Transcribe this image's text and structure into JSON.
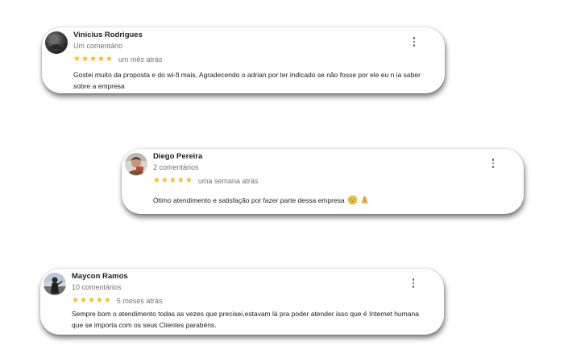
{
  "reviews": [
    {
      "author": "Vinicius Rodrigues",
      "review_count": "Um comentário",
      "stars": [
        "★",
        "★",
        "★",
        "★",
        "★"
      ],
      "rating": 5,
      "date": "um mês atrás",
      "text": "Gostei muito da proposta e do wi-fi mais, Agradecendo o adrian por ter indicado se não fosse por ele eu n ia saber sobre a empresa",
      "avatar_icon": "dark-photo-avatar"
    },
    {
      "author": "Diego Pereira",
      "review_count": "2 comentários",
      "stars": [
        "★",
        "★",
        "★",
        "★",
        "★"
      ],
      "rating": 5,
      "date": "uma semana atrás",
      "text": "Ótimo atendimento e satisfação por fazer parte dessa empresa",
      "emojis": [
        "grinning-face-emoji",
        "folded-hands-emoji"
      ],
      "avatar_icon": "person-photo-avatar"
    },
    {
      "author": "Maycon Ramos",
      "review_count": "10 comentários",
      "stars": [
        "★",
        "★",
        "★",
        "★",
        "★"
      ],
      "rating": 5,
      "date": "5 meses atrás",
      "text": "Sempre bom o atendimento todas as vezes que precisei,estavam lá pra poder atender isso que é Internet humana que se importa com os seus Clientes parabéns.",
      "avatar_icon": "outdoor-photo-avatar"
    }
  ],
  "colors": {
    "star": "#fbbc04",
    "name": "#202124",
    "secondary": "#70757a",
    "card_background": "#ffffff"
  },
  "icons": {
    "more_options": "more-vertical-icon",
    "star": "star-icon"
  }
}
